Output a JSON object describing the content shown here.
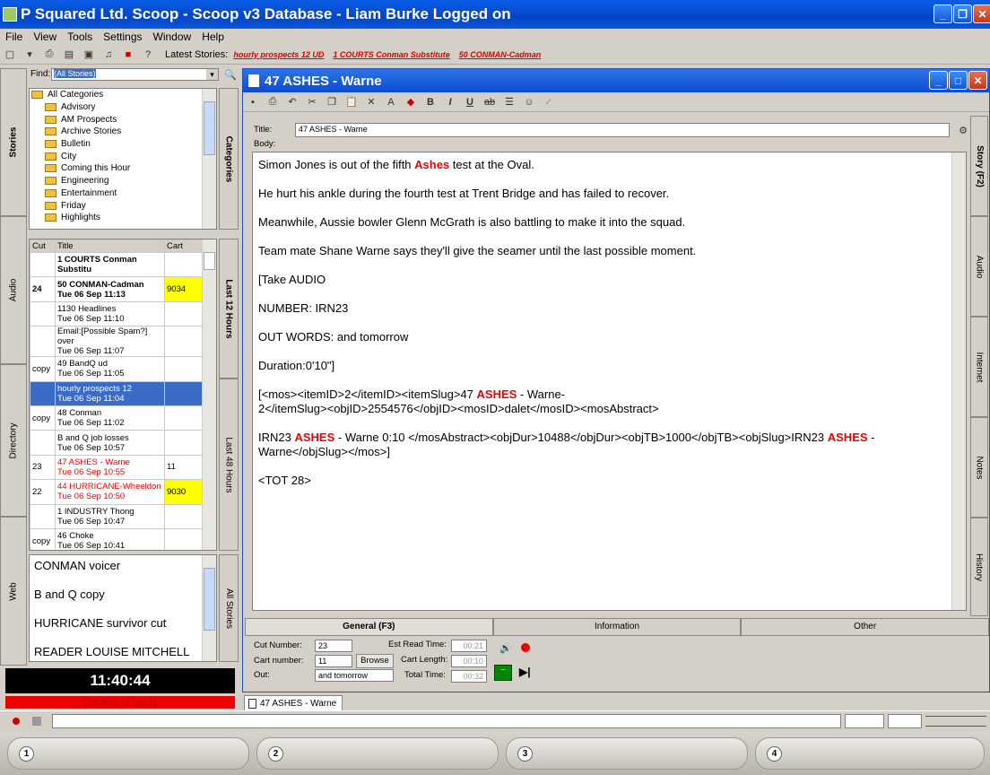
{
  "window": {
    "title": "P Squared Ltd. Scoop - Scoop v3 Database - Liam Burke Logged on"
  },
  "menu": [
    "File",
    "View",
    "Tools",
    "Settings",
    "Window",
    "Help"
  ],
  "latest": {
    "label": "Latest Stories:",
    "links": [
      "hourly prospects 12 UD",
      "1 COURTS Conman Substitute",
      "50 CONMAN-Cadman"
    ]
  },
  "find": {
    "label": "Find:",
    "value": "(All Stories)"
  },
  "left_tabs": [
    "Stories",
    "Audio",
    "Directory",
    "Web"
  ],
  "categories": {
    "items": [
      "All Categories",
      "Advisory",
      "AM Prospects",
      "Archive Stories",
      "Bulletin",
      "City",
      "Coming this Hour",
      "Engineering",
      "Entertainment",
      "Friday",
      "Highlights"
    ],
    "tab": "Categories"
  },
  "list": {
    "headers": [
      "Cut",
      "Title",
      "Cart"
    ],
    "tab": "Last 12 Hours",
    "tab2": "Last 48 Hours",
    "rows": [
      {
        "cut": "",
        "title": "1 COURTS Conman Substitu",
        "time": "",
        "cart": "",
        "bold": true
      },
      {
        "cut": "24",
        "title": "50 CONMAN-Cadman",
        "time": "Tue 06 Sep 11:13",
        "cart": "9034",
        "bold": true,
        "yellow": true
      },
      {
        "cut": "",
        "title": "1130 Headlines",
        "time": "Tue 06 Sep 11:10",
        "cart": ""
      },
      {
        "cut": "",
        "title": "Email:[Possible Spam?] over",
        "time": "Tue 06 Sep 11:07",
        "cart": ""
      },
      {
        "cut": "copy",
        "title": "49 BandQ ud",
        "time": "Tue 06 Sep 11:05",
        "cart": ""
      },
      {
        "cut": "",
        "title": "hourly prospects 12",
        "time": "Tue 06 Sep 11:04",
        "cart": "",
        "selected": true
      },
      {
        "cut": "copy",
        "title": "48 Conman",
        "time": "Tue 06 Sep 11:02",
        "cart": ""
      },
      {
        "cut": "",
        "title": "B and Q job losses",
        "time": "Tue 06 Sep 10:57",
        "cart": ""
      },
      {
        "cut": "23",
        "title": "47 ASHES - Warne",
        "time": "Tue 06 Sep 10:55",
        "cart": "11",
        "red": true
      },
      {
        "cut": "22",
        "title": "44 HURRICANE-Wheeldon",
        "time": "Tue 06 Sep 10:50",
        "cart": "9030",
        "red": true,
        "yellow": true
      },
      {
        "cut": "",
        "title": "1 INDUSTRY Thong",
        "time": "Tue 06 Sep 10:47",
        "cart": ""
      },
      {
        "cut": "copy",
        "title": "46 Choke",
        "time": "Tue 06 Sep 10:41",
        "cart": ""
      }
    ]
  },
  "notes": {
    "items": [
      "CONMAN voicer",
      "B and Q copy",
      "HURRICANE survivor cut",
      "READER LOUISE MITCHELL"
    ],
    "tab": "All Stories"
  },
  "clock": "11:40:44",
  "status_link": "Cart 9034 - 11:40:01",
  "doc": {
    "title": "47 ASHES - Warne",
    "title_label": "Title:",
    "title_value": "47 ASHES - Warne",
    "body_label": "Body:",
    "right_tabs": [
      "Story (F2)",
      "Audio",
      "Internet",
      "Notes",
      "History"
    ],
    "body": {
      "p1a": "Simon Jones is out of the fifth ",
      "p1b": "Ashes",
      "p1c": " test at the Oval.",
      "p2": "He hurt his ankle during the fourth test at Trent Bridge and has failed to recover.",
      "p3": "Meanwhile, Aussie bowler Glenn McGrath is also battling to make it into the squad.",
      "p4": "Team mate Shane Warne says they'll give the seamer until the last possible moment.",
      "p5": "[Take AUDIO",
      "p6": "NUMBER: IRN23",
      "p7": "OUT WORDS: and tomorrow",
      "p8": "Duration:0'10\"]",
      "p9a": "[<mos><itemID>2</itemID><itemSlug>47 ",
      "p9b": "ASHES",
      "p9c": " - Warne-",
      "p9d": "2</itemSlug><objID>2554576</objID><mosID>dalet</mosID><mosAbstract>",
      "p10a": "IRN23 ",
      "p10b": "ASHES",
      "p10c": " - Warne 0:10 </mosAbstract><objDur>10488</objDur><objTB>1000</objTB><objSlug>IRN23 ",
      "p10d": "ASHES",
      "p10e": " -",
      "p10f": "Warne</objSlug></mos>]",
      "p11": "<TOT 28>"
    },
    "tabs": [
      "General (F3)",
      "Information",
      "Other"
    ],
    "general": {
      "cut_label": "Cut Number:",
      "cut": "23",
      "cart_label": "Cart number:",
      "cart": "11",
      "browse": "Browse",
      "out_label": "Out:",
      "out": "and tomorrow",
      "est_label": "Est Read Time:",
      "est": "00:21",
      "len_label": "Cart Length:",
      "len": "00:10",
      "total_label": "Total Time:",
      "total": "00:32"
    },
    "doc_tab": "47 ASHES - Warne"
  },
  "players": [
    "1",
    "2",
    "3",
    "4"
  ]
}
